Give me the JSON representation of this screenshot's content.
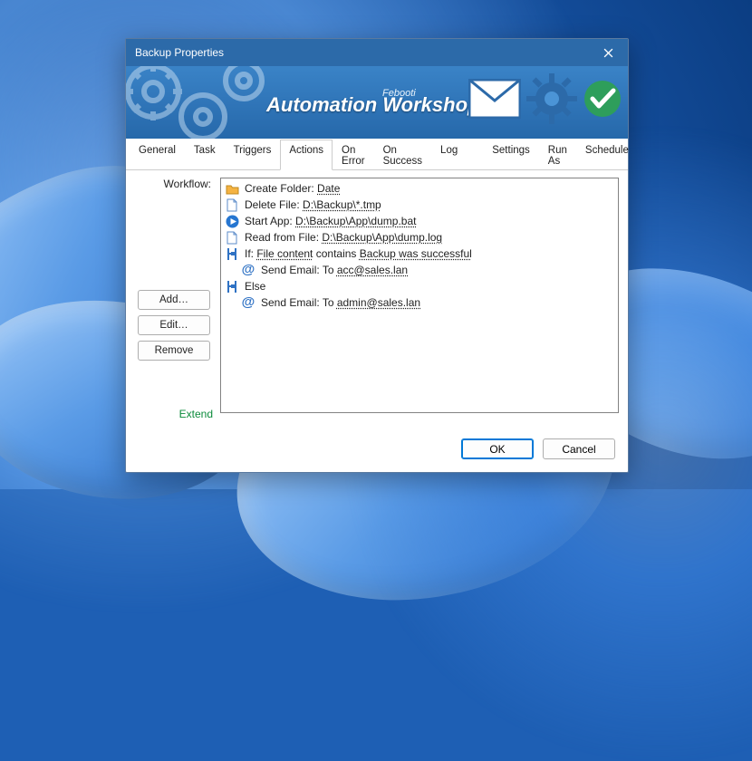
{
  "window": {
    "title": "Backup Properties"
  },
  "banner": {
    "brand_small": "Febooti",
    "brand_big": "Automation Workshop"
  },
  "tabs": [
    "General",
    "Task",
    "Triggers",
    "Actions",
    "On Error",
    "On Success",
    "Log",
    "Settings",
    "Run As",
    "Schedule"
  ],
  "active_tab": "Actions",
  "left": {
    "label": "Workflow:",
    "add": "Add…",
    "edit": "Edit…",
    "remove": "Remove",
    "extend": "Extend"
  },
  "workflow": [
    {
      "icon": "folder",
      "indent": 0,
      "prefix": "Create Folder: ",
      "link": "Date"
    },
    {
      "icon": "file",
      "indent": 0,
      "prefix": "Delete File: ",
      "link": "D:\\Backup\\*.tmp"
    },
    {
      "icon": "play",
      "indent": 0,
      "prefix": "Start App: ",
      "link": "D:\\Backup\\App\\dump.bat"
    },
    {
      "icon": "file",
      "indent": 0,
      "prefix": "Read from File: ",
      "link": "D:\\Backup\\App\\dump.log"
    },
    {
      "icon": "bracket",
      "indent": 0,
      "prefix": "If: ",
      "link": "File content",
      "middle": " contains ",
      "link2": "Backup was successful"
    },
    {
      "icon": "at",
      "indent": 1,
      "prefix": "Send Email: To ",
      "link": "acc@sales.lan"
    },
    {
      "icon": "bracket",
      "indent": 0,
      "prefix": "Else"
    },
    {
      "icon": "at",
      "indent": 1,
      "prefix": "Send Email: To ",
      "link": "admin@sales.lan"
    }
  ],
  "footer": {
    "ok": "OK",
    "cancel": "Cancel"
  },
  "ghost": {
    "ok": "OK",
    "cancel": "Cancel"
  }
}
